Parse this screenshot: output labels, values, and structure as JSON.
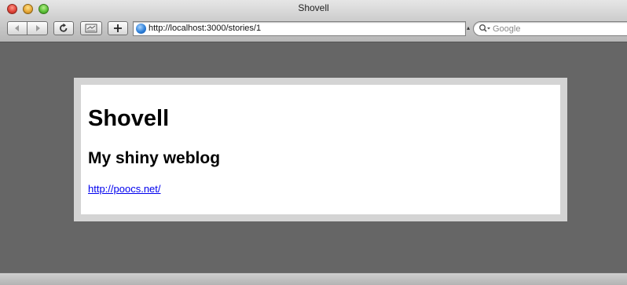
{
  "window": {
    "title": "Shovell"
  },
  "toolbar": {
    "url": "http://localhost:3000/stories/1",
    "search_placeholder": "Google"
  },
  "page": {
    "heading": "Shovell",
    "subheading": "My shiny weblog",
    "link": "http://poocs.net/"
  },
  "icons": {
    "close": "close-light-icon",
    "minimize": "minimize-light-icon",
    "zoom": "zoom-light-icon",
    "back": "back-arrow-icon",
    "forward": "forward-arrow-icon",
    "reload": "reload-icon",
    "snapback": "snapback-icon",
    "add_bookmark": "plus-icon",
    "site": "globe-icon",
    "search": "magnifier-icon"
  },
  "colors": {
    "desktop": "#666666",
    "page_border": "#d4d4d4",
    "link": "#0000ee"
  }
}
